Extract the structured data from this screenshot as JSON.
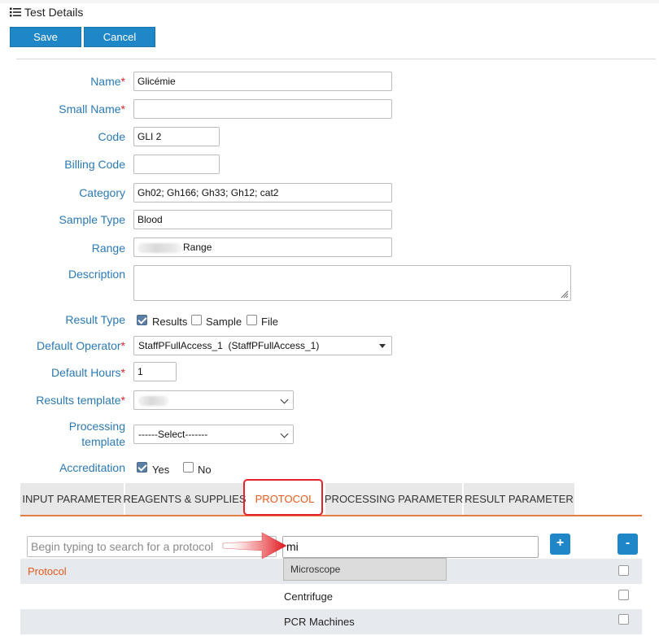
{
  "header": {
    "title": "Test Details",
    "save_label": "Save",
    "cancel_label": "Cancel"
  },
  "form": {
    "name": {
      "label": "Name",
      "value": "Glicémie"
    },
    "small_name": {
      "label": "Small Name",
      "value": ""
    },
    "code": {
      "label": "Code",
      "value": "GLI 2"
    },
    "billing_code": {
      "label": "Billing Code",
      "value": ""
    },
    "category": {
      "label": "Category",
      "value": "Gh02; Gh166; Gh33; Gh12; cat2"
    },
    "sample_type": {
      "label": "Sample Type",
      "value": "Blood"
    },
    "range": {
      "label": "Range",
      "value": "Range"
    },
    "description": {
      "label": "Description",
      "value": ""
    },
    "result_type": {
      "label": "Result Type",
      "options": [
        "Results",
        "Sample",
        "File"
      ],
      "checked": [
        true,
        false,
        false
      ]
    },
    "default_operator": {
      "label": "Default Operator",
      "value": "StaffPFullAccess_1  (StaffPFullAccess_1)"
    },
    "default_hours": {
      "label": "Default Hours",
      "value": "1"
    },
    "results_template": {
      "label": "Results template",
      "value": ""
    },
    "processing_template": {
      "label_line1": "Processing",
      "label_line2": "template",
      "value": "------Select-------"
    },
    "accreditation": {
      "label": "Accreditation",
      "options": [
        "Yes",
        "No"
      ],
      "checked": [
        true,
        false
      ]
    }
  },
  "tabs": [
    "INPUT PARAMETER",
    "REAGENTS & SUPPLIES",
    "PROTOCOL",
    "PROCESSING PARAMETER",
    "RESULT PARAMETER"
  ],
  "active_tab": "PROTOCOL",
  "protocol": {
    "search_placeholder": "Begin typing to search for a protocol",
    "search_value": "mi",
    "add_label": "+",
    "remove_label": "-",
    "column_label": "Protocol",
    "suggestion": "Microscope",
    "rows": [
      "Centrifuge",
      "PCR Machines"
    ]
  },
  "colors": {
    "accent": "#1f86c8",
    "label": "#2a79b4",
    "required": "#d9232e",
    "active_tab": "#e45b1e",
    "highlight": "#e5232a"
  }
}
